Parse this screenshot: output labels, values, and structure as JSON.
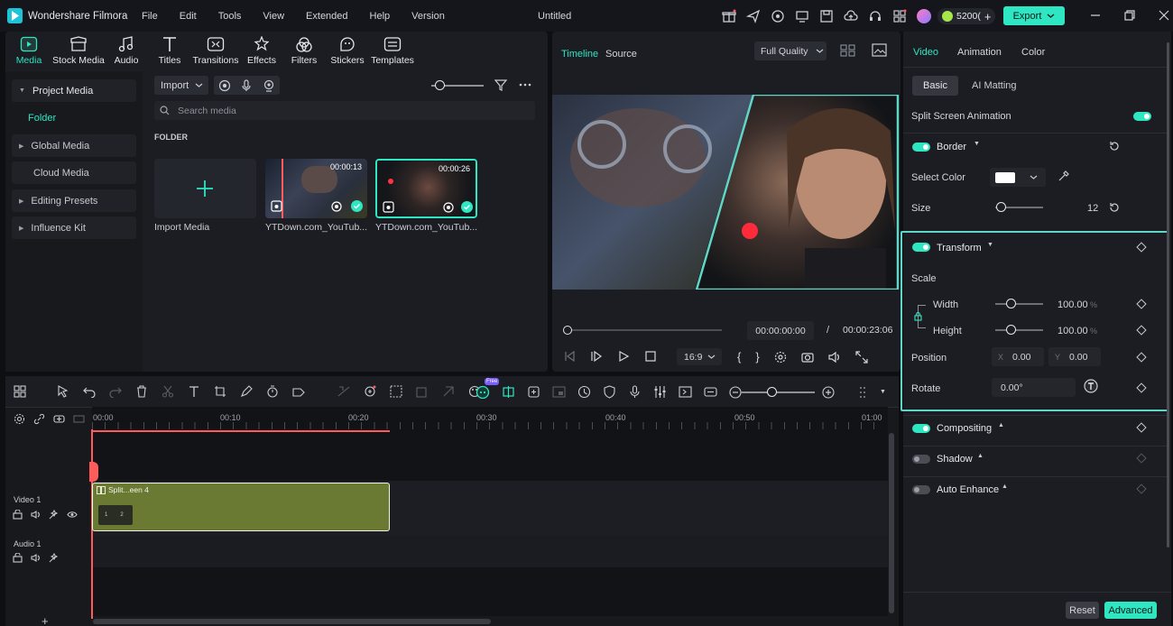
{
  "app": {
    "name": "Wondershare Filmora",
    "title": "Untitled",
    "credits": "5200(",
    "export_label": "Export"
  },
  "menu": [
    "File",
    "Edit",
    "Tools",
    "View",
    "Extended",
    "Help",
    "Version"
  ],
  "media_tabs": [
    {
      "label": "Media",
      "icon": "media-icon",
      "active": true
    },
    {
      "label": "Stock Media",
      "icon": "stock-media-icon"
    },
    {
      "label": "Audio",
      "icon": "audio-icon"
    },
    {
      "label": "Titles",
      "icon": "titles-icon"
    },
    {
      "label": "Transitions",
      "icon": "transitions-icon"
    },
    {
      "label": "Effects",
      "icon": "effects-icon"
    },
    {
      "label": "Filters",
      "icon": "filters-icon"
    },
    {
      "label": "Stickers",
      "icon": "stickers-icon"
    },
    {
      "label": "Templates",
      "icon": "templates-icon"
    }
  ],
  "sidebar": {
    "project_media": "Project Media",
    "folder": "Folder",
    "items": [
      "Global Media",
      "Cloud Media",
      "Editing Presets",
      "Influence Kit"
    ]
  },
  "media": {
    "import_label": "Import",
    "search_placeholder": "Search media",
    "folder_header": "FOLDER",
    "import_media_label": "Import Media",
    "clips": [
      {
        "name": "YTDown.com_YouTub...",
        "duration": "00:00:13"
      },
      {
        "name": "YTDown.com_YouTub...",
        "duration": "00:00:26"
      }
    ]
  },
  "preview": {
    "tab_timeline": "Timeline",
    "tab_source": "Source",
    "quality": "Full Quality",
    "current_time": "00:00:00:00",
    "separator": "/",
    "total_time": "00:00:23:06",
    "aspect": "16:9"
  },
  "inspector": {
    "tabs": [
      "Video",
      "Animation",
      "Color"
    ],
    "subtabs": [
      "Basic",
      "AI Matting"
    ],
    "split_screen_animation": "Split Screen Animation",
    "border": {
      "label": "Border",
      "select_color": "Select Color",
      "size_label": "Size",
      "size_value": "12"
    },
    "transform": {
      "label": "Transform",
      "scale": "Scale",
      "width_label": "Width",
      "width_value": "100.00",
      "width_unit": "%",
      "height_label": "Height",
      "height_value": "100.00",
      "height_unit": "%",
      "position_label": "Position",
      "x_label": "X",
      "x_value": "0.00",
      "y_label": "Y",
      "y_value": "0.00",
      "rotate_label": "Rotate",
      "rotate_value": "0.00°"
    },
    "compositing": "Compositing",
    "shadow": "Shadow",
    "auto_enhance": "Auto Enhance",
    "reset_label": "Reset",
    "advanced_label": "Advanced"
  },
  "timeline": {
    "ticks": [
      "00:00",
      "00:10",
      "00:20",
      "00:30",
      "00:40",
      "00:50",
      "01:00"
    ],
    "free_badge": "Free",
    "tracks": [
      {
        "label": "Video 1"
      },
      {
        "label": "Audio 1"
      }
    ],
    "clip_name": "Split...een 4",
    "clip_parts": [
      "1",
      "2"
    ]
  },
  "colors": {
    "accent": "#2ee6c2",
    "playhead": "#ff5b5b",
    "clip": "#6a7a32"
  }
}
